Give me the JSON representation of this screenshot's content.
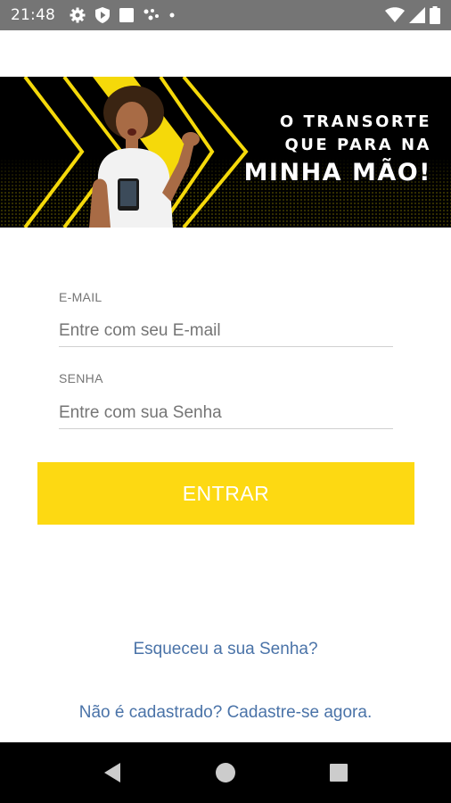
{
  "status_bar": {
    "time": "21:48",
    "left_icons": [
      "gear-icon",
      "shield-play-icon",
      "square-notification-icon",
      "dots-icon",
      "small-dot-icon"
    ],
    "right_icons": [
      "wifi-icon",
      "cell-signal-icon",
      "battery-icon"
    ]
  },
  "banner": {
    "line1": "O TRANSORTE",
    "line2": "QUE PARA NA",
    "line3": "MINHA MÃO!",
    "accent_color": "#f5d90a",
    "background_color": "#000000"
  },
  "form": {
    "email_label": "E-MAIL",
    "email_placeholder": "Entre com seu E-mail",
    "email_value": "",
    "password_label": "SENHA",
    "password_placeholder": "Entre com sua Senha",
    "password_value": "",
    "submit_label": "ENTRAR",
    "submit_color": "#fdd912"
  },
  "links": {
    "forgot_password": "Esqueceu a sua Senha?",
    "register": "Não é cadastrado? Cadastre-se agora.",
    "link_color": "#4a73a8"
  },
  "nav_bar": {
    "buttons": [
      "back-icon",
      "home-icon",
      "recents-icon"
    ]
  }
}
